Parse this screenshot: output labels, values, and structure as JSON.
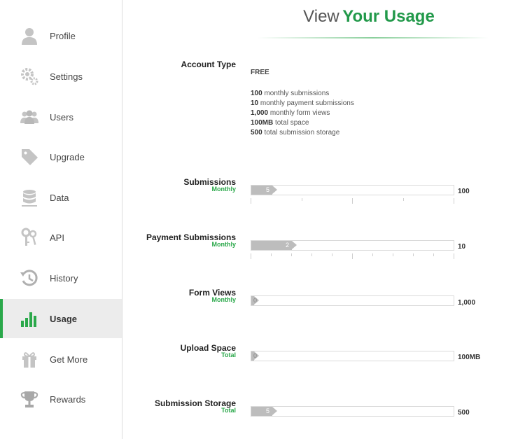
{
  "sidebar": {
    "items": [
      {
        "label": "Profile",
        "icon": "person-icon"
      },
      {
        "label": "Settings",
        "icon": "gears-icon"
      },
      {
        "label": "Users",
        "icon": "users-icon"
      },
      {
        "label": "Upgrade",
        "icon": "tag-icon"
      },
      {
        "label": "Data",
        "icon": "database-icon"
      },
      {
        "label": "API",
        "icon": "keys-icon"
      },
      {
        "label": "History",
        "icon": "history-icon"
      },
      {
        "label": "Usage",
        "icon": "bar-chart-icon",
        "active": true
      },
      {
        "label": "Get More",
        "icon": "gift-icon"
      },
      {
        "label": "Rewards",
        "icon": "trophy-icon"
      }
    ]
  },
  "title": {
    "prefix": "View",
    "highlight": "Your Usage"
  },
  "account": {
    "label": "Account Type",
    "type": "FREE",
    "limits": [
      {
        "value": "100",
        "text": "monthly submissions"
      },
      {
        "value": "10",
        "text": "monthly payment submissions"
      },
      {
        "value": "1,000",
        "text": "monthly form views"
      },
      {
        "value": "100MB",
        "text": "total space"
      },
      {
        "value": "500",
        "text": "total submission storage"
      }
    ]
  },
  "usage": [
    {
      "label": "Submissions",
      "period": "Monthly",
      "value": "5",
      "fraction": 0.05,
      "max": "100",
      "ticks": 5
    },
    {
      "label": "Payment Submissions",
      "period": "Monthly",
      "value": "2",
      "fraction": 0.2,
      "max": "10",
      "ticks": 11
    },
    {
      "label": "Form Views",
      "period": "Monthly",
      "value": "0",
      "fraction": 0,
      "max": "1,000",
      "ticks": 0
    },
    {
      "label": "Upload Space",
      "period": "Total",
      "value": "0",
      "fraction": 0,
      "max": "100MB",
      "ticks": 0
    },
    {
      "label": "Submission Storage",
      "period": "Total",
      "value": "5",
      "fraction": 0.01,
      "max": "500",
      "ticks": 0
    }
  ],
  "colors": {
    "accent": "#2aa84a",
    "bar": "#bdbdbd",
    "active_bg": "#ececec"
  }
}
